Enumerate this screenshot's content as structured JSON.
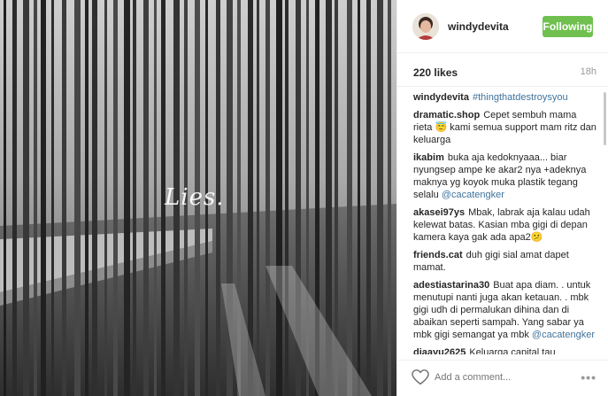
{
  "photo": {
    "caption": "Lies."
  },
  "post": {
    "username": "windydevita",
    "follow_label": "Following",
    "likes": "220 likes",
    "time": "18h"
  },
  "comments": [
    {
      "user": "windydevita",
      "text": "",
      "hashtag": "#thingthatdestroysyou",
      "mention": ""
    },
    {
      "user": "dramatic.shop",
      "text": "Cepet sembuh mama rieta 😇 kami semua support mam ritz dan keluarga",
      "hashtag": "",
      "mention": ""
    },
    {
      "user": "ikabim",
      "text": "buka aja kedoknyaaa... biar nyungsep ampe ke akar2 nya +adeknya maknya yg koyok muka plastik tegang selalu",
      "hashtag": "",
      "mention": "@cacatengker"
    },
    {
      "user": "akasei97ys",
      "text": "Mbak, labrak aja kalau udah kelewat batas. Kasian mba gigi di depan kamera kaya gak ada apa2😕",
      "hashtag": "",
      "mention": ""
    },
    {
      "user": "friends.cat",
      "text": "duh gigi sial amat dapet mamat.",
      "hashtag": "",
      "mention": ""
    },
    {
      "user": "adestiastarina30",
      "text": "Buat apa diam. . untuk menutupi nanti juga akan ketauan. . mbk gigi udh di permalukan dihina dan di abaikan seperti sampah. Yang sabar ya mbk gigi semangat ya mbk",
      "hashtag": "",
      "mention": "@cacatengker"
    },
    {
      "user": "diaayu2625",
      "text": "Keluarga capital tau bagaimana menutupi masalah. mba gigi",
      "hashtag": "",
      "mention": ""
    }
  ],
  "footer": {
    "add_comment_placeholder": "Add a comment...",
    "more_label": "•••"
  },
  "icons": {
    "heart": "heart-icon",
    "more": "more-options-icon"
  },
  "colors": {
    "follow_button": "#70c050",
    "link": "#3f729b"
  }
}
